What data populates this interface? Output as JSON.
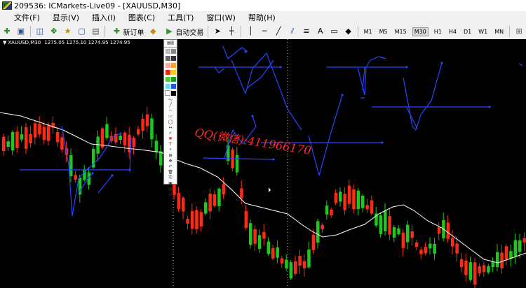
{
  "window": {
    "title": "209536: ICMarkets-Live09 - [XAUUSD,M30]"
  },
  "menu": {
    "items": [
      "文件(F)",
      "显示(V)",
      "插入(I)",
      "图表(C)",
      "工具(T)",
      "窗口(W)",
      "帮助(H)"
    ]
  },
  "toolbar": {
    "new_order_label": "新订单",
    "autotrade_label": "自动交易",
    "timeframes": [
      "M1",
      "M5",
      "M15",
      "M30",
      "H1",
      "H4",
      "D1",
      "W1",
      "MN"
    ],
    "active_timeframe": "M30"
  },
  "chart": {
    "symbol": "XAUUSD,M30",
    "ohlc": "1275.05 1275.10 1274.95 1274.95",
    "watermark": "QQ(微信):411966170",
    "palette_title": "画图",
    "colors": {
      "bull": "#1ec81e",
      "bear": "#ff2a15",
      "ma": "#ffffff",
      "lines": "#2545ff",
      "watermark": "#ff2a2a"
    }
  }
}
